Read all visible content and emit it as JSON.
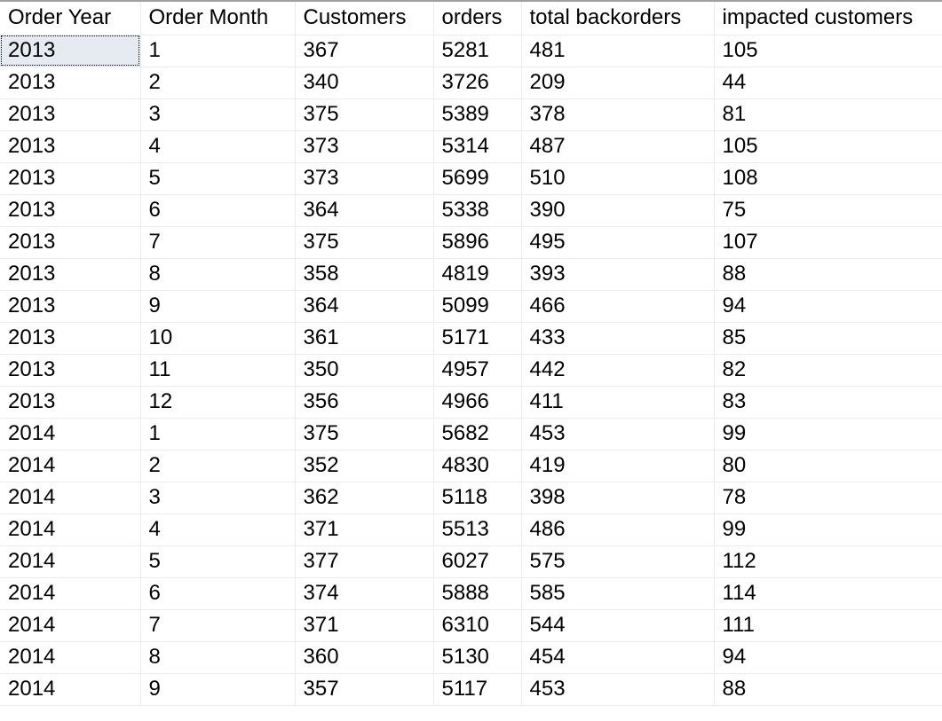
{
  "results_grid": {
    "columns": [
      "Order Year",
      "Order Month",
      "Customers",
      "orders",
      "total backorders",
      "impacted customers"
    ],
    "selected_cell": {
      "row": 0,
      "column": 0
    },
    "rows": [
      [
        "2013",
        "1",
        "367",
        "5281",
        "481",
        "105"
      ],
      [
        "2013",
        "2",
        "340",
        "3726",
        "209",
        "44"
      ],
      [
        "2013",
        "3",
        "375",
        "5389",
        "378",
        "81"
      ],
      [
        "2013",
        "4",
        "373",
        "5314",
        "487",
        "105"
      ],
      [
        "2013",
        "5",
        "373",
        "5699",
        "510",
        "108"
      ],
      [
        "2013",
        "6",
        "364",
        "5338",
        "390",
        "75"
      ],
      [
        "2013",
        "7",
        "375",
        "5896",
        "495",
        "107"
      ],
      [
        "2013",
        "8",
        "358",
        "4819",
        "393",
        "88"
      ],
      [
        "2013",
        "9",
        "364",
        "5099",
        "466",
        "94"
      ],
      [
        "2013",
        "10",
        "361",
        "5171",
        "433",
        "85"
      ],
      [
        "2013",
        "11",
        "350",
        "4957",
        "442",
        "82"
      ],
      [
        "2013",
        "12",
        "356",
        "4966",
        "411",
        "83"
      ],
      [
        "2014",
        "1",
        "375",
        "5682",
        "453",
        "99"
      ],
      [
        "2014",
        "2",
        "352",
        "4830",
        "419",
        "80"
      ],
      [
        "2014",
        "3",
        "362",
        "5118",
        "398",
        "78"
      ],
      [
        "2014",
        "4",
        "371",
        "5513",
        "486",
        "99"
      ],
      [
        "2014",
        "5",
        "377",
        "6027",
        "575",
        "112"
      ],
      [
        "2014",
        "6",
        "374",
        "5888",
        "585",
        "114"
      ],
      [
        "2014",
        "7",
        "371",
        "6310",
        "544",
        "111"
      ],
      [
        "2014",
        "8",
        "360",
        "5130",
        "454",
        "94"
      ],
      [
        "2014",
        "9",
        "357",
        "5117",
        "453",
        "88"
      ]
    ]
  },
  "colors": {
    "grid_line": "#ececec",
    "selected_cell_bg": "#e6ebf1",
    "top_border": "#a0a0a0"
  }
}
